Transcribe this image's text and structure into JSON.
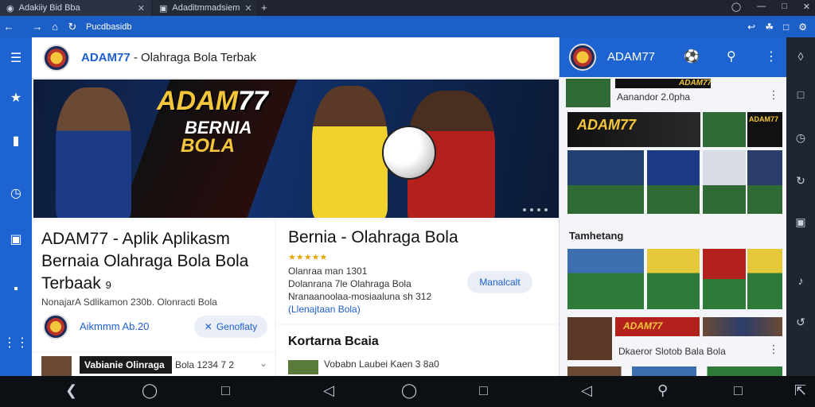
{
  "browser": {
    "tabs": [
      {
        "label": "Adakiiy Bid Bba"
      },
      {
        "label": "Adaditmmadsiem"
      }
    ],
    "new_tab_icon": "plus-icon",
    "url": "Pucdbasidb"
  },
  "main": {
    "header_brand": "ADAM77",
    "header_title": " - Olahraga Bola  Terbak",
    "hero": {
      "title_part1": "ADAM",
      "title_part2": "77",
      "line2": "BERNIA",
      "line3": "BOLA"
    },
    "card1": {
      "heading": "ADAM77 - Aplik Aplikasm Bernaia Olahraga Bola Bola Terbaak",
      "heading_suffix": "9",
      "subtitle": "NonajarA Sdlikamon 230b. Olonracti Bola",
      "author": "Aikmmm Ab.20",
      "action": "Genoflaty"
    },
    "card2": {
      "heading": "Bernia - Olahraga Bola",
      "stars": "★★★★★ ",
      "meta_line1": "Olanraa man 1301",
      "meta_line2": "Dolanrana 7le Olahraga Bola",
      "meta_line3": "Nranaanoolaa-mosiaaluna sh 312",
      "meta_line4": "(Llenajtaan Bola)",
      "action": "Manalcalt"
    },
    "card3": {
      "heading": "Kortarna Bcaia",
      "row_text": "Vobabn Laubei Kaen 3 8a0"
    },
    "card4": {
      "label": "Vabianie Olinraga",
      "text": "Bola 1234 7 2"
    }
  },
  "right_panel": {
    "title": "ADAM77",
    "top_label": "Aanandor 2.0pha",
    "banner_top": "ADAM77",
    "banner_mid": "ADAM77",
    "banner_mid_right": "ADAM77",
    "section_title": "Tamhetang",
    "banner_bottom": "ADAM77",
    "bottom_label": "Dkaeror Slotob Bala Bola"
  },
  "colors": {
    "accent": "#1d63d1",
    "gold": "#f3c63b"
  }
}
